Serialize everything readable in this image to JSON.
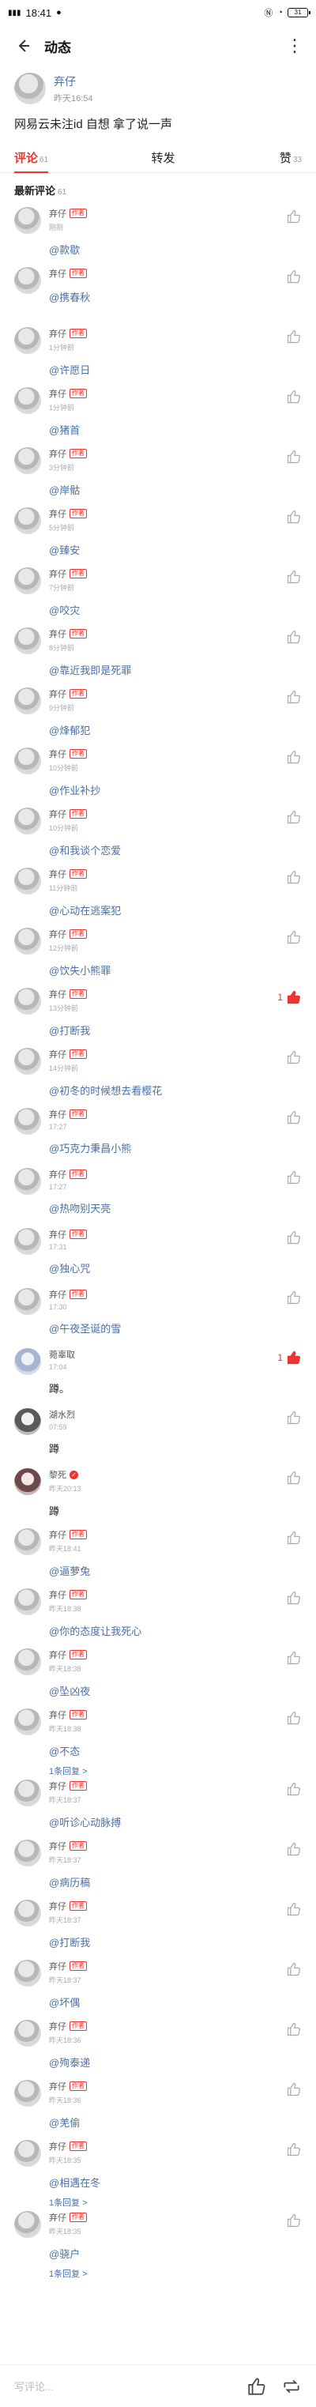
{
  "status": {
    "time": "18:41",
    "left_icons": "HD",
    "battery": "31"
  },
  "header": {
    "title": "动态"
  },
  "post": {
    "author": "弃仔",
    "time": "昨天16:54",
    "text": "网易云未注id 自想 拿了说一声"
  },
  "tabs": [
    {
      "label": "评论",
      "count": "61"
    },
    {
      "label": "转发",
      "count": ""
    },
    {
      "label": "赞",
      "count": "33"
    }
  ],
  "section": {
    "title": "最新评论",
    "count": "61"
  },
  "badge_text": "作者",
  "comments": [
    {
      "name": "弃仔",
      "badge": true,
      "time": "刚刚",
      "text": "@款歇",
      "likes": "",
      "liked": false,
      "replies": ""
    },
    {
      "name": "弃仔",
      "badge": true,
      "time": "",
      "text": "@携春秋",
      "likes": "",
      "liked": false,
      "replies": ""
    },
    {
      "name": "弃仔",
      "badge": true,
      "time": "1分钟前",
      "text": "@许愿日",
      "likes": "",
      "liked": false,
      "replies": ""
    },
    {
      "name": "弃仔",
      "badge": true,
      "time": "1分钟前",
      "text": "@猪首",
      "likes": "",
      "liked": false,
      "replies": ""
    },
    {
      "name": "弃仔",
      "badge": true,
      "time": "3分钟前",
      "text": "@岸骷",
      "likes": "",
      "liked": false,
      "replies": ""
    },
    {
      "name": "弃仔",
      "badge": true,
      "time": "5分钟前",
      "text": "@臻安",
      "likes": "",
      "liked": false,
      "replies": ""
    },
    {
      "name": "弃仔",
      "badge": true,
      "time": "7分钟前",
      "text": "@咬灾",
      "likes": "",
      "liked": false,
      "replies": ""
    },
    {
      "name": "弃仔",
      "badge": true,
      "time": "8分钟前",
      "text": "@靠近我即是死罪",
      "likes": "",
      "liked": false,
      "replies": ""
    },
    {
      "name": "弃仔",
      "badge": true,
      "time": "9分钟前",
      "text": "@烽郁犯",
      "likes": "",
      "liked": false,
      "replies": ""
    },
    {
      "name": "弃仔",
      "badge": true,
      "time": "10分钟前",
      "text": "@作业补抄",
      "likes": "",
      "liked": false,
      "replies": ""
    },
    {
      "name": "弃仔",
      "badge": true,
      "time": "10分钟前",
      "text": "@和我谈个恋爱",
      "likes": "",
      "liked": false,
      "replies": ""
    },
    {
      "name": "弃仔",
      "badge": true,
      "time": "11分钟前",
      "text": "@心动在逃案犯",
      "likes": "",
      "liked": false,
      "replies": ""
    },
    {
      "name": "弃仔",
      "badge": true,
      "time": "12分钟前",
      "text": "@饮失小熊罪",
      "likes": "",
      "liked": false,
      "replies": ""
    },
    {
      "name": "弃仔",
      "badge": true,
      "time": "13分钟前",
      "text": "@打断我",
      "likes": "1",
      "liked": true,
      "replies": ""
    },
    {
      "name": "弃仔",
      "badge": true,
      "time": "14分钟前",
      "text": "@初冬的时候想去看樱花",
      "likes": "",
      "liked": false,
      "replies": ""
    },
    {
      "name": "弃仔",
      "badge": true,
      "time": "17:27",
      "text": "@巧克力秉昌小熊",
      "likes": "",
      "liked": false,
      "replies": ""
    },
    {
      "name": "弃仔",
      "badge": true,
      "time": "17:27",
      "text": "@热吻别天亮",
      "likes": "",
      "liked": false,
      "replies": ""
    },
    {
      "name": "弃仔",
      "badge": true,
      "time": "17:31",
      "text": "@独心咒",
      "likes": "",
      "liked": false,
      "replies": ""
    },
    {
      "name": "弃仔",
      "badge": true,
      "time": "17:30",
      "text": "@午夜圣诞的雪",
      "likes": "",
      "liked": false,
      "replies": ""
    },
    {
      "name": "菀辜取",
      "badge": false,
      "time": "17:04",
      "text": "蹲。",
      "likes": "1",
      "liked": true,
      "replies": "",
      "plain": true,
      "avatar": "alt1"
    },
    {
      "name": "湖水烈",
      "badge": false,
      "time": "07:59",
      "text": "蹲",
      "likes": "",
      "liked": false,
      "replies": "",
      "plain": true,
      "avatar": "alt2"
    },
    {
      "name": "黎死",
      "badge": false,
      "vip": true,
      "time": "昨天20:13",
      "text": "蹲",
      "likes": "",
      "liked": false,
      "replies": "",
      "plain": true,
      "avatar": "alt3"
    },
    {
      "name": "弃仔",
      "badge": true,
      "time": "昨天18:41",
      "text": "@逼萝兔",
      "likes": "",
      "liked": false,
      "replies": ""
    },
    {
      "name": "弃仔",
      "badge": true,
      "time": "昨天18:38",
      "text": "@你的态度让我死心",
      "likes": "",
      "liked": false,
      "replies": ""
    },
    {
      "name": "弃仔",
      "badge": true,
      "time": "昨天18:38",
      "text": "@坠凶夜",
      "likes": "",
      "liked": false,
      "replies": ""
    },
    {
      "name": "弃仔",
      "badge": true,
      "time": "昨天18:38",
      "text": "@不态",
      "likes": "",
      "liked": false,
      "replies": "1条回复 >"
    },
    {
      "name": "弃仔",
      "badge": true,
      "time": "昨天18:37",
      "text": "@听诊心动脉搏",
      "likes": "",
      "liked": false,
      "replies": ""
    },
    {
      "name": "弃仔",
      "badge": true,
      "time": "昨天18:37",
      "text": "@病历稿",
      "likes": "",
      "liked": false,
      "replies": ""
    },
    {
      "name": "弃仔",
      "badge": true,
      "time": "昨天18:37",
      "text": "@打断我",
      "likes": "",
      "liked": false,
      "replies": ""
    },
    {
      "name": "弃仔",
      "badge": true,
      "time": "昨天18:37",
      "text": "@坏偶",
      "likes": "",
      "liked": false,
      "replies": ""
    },
    {
      "name": "弃仔",
      "badge": true,
      "time": "昨天18:36",
      "text": "@殉泰递",
      "likes": "",
      "liked": false,
      "replies": ""
    },
    {
      "name": "弃仔",
      "badge": true,
      "time": "昨天18:36",
      "text": "@羌偷",
      "likes": "",
      "liked": false,
      "replies": ""
    },
    {
      "name": "弃仔",
      "badge": true,
      "time": "昨天18:35",
      "text": "@相遇在冬",
      "likes": "",
      "liked": false,
      "replies": "1条回复 >"
    },
    {
      "name": "弃仔",
      "badge": true,
      "time": "昨天18:35",
      "text": "@骁户",
      "likes": "",
      "liked": false,
      "replies": "1条回复 >"
    }
  ],
  "bottom": {
    "placeholder": "写评论..."
  },
  "colors": {
    "accent": "#e33333",
    "link": "#4a6fa5"
  }
}
